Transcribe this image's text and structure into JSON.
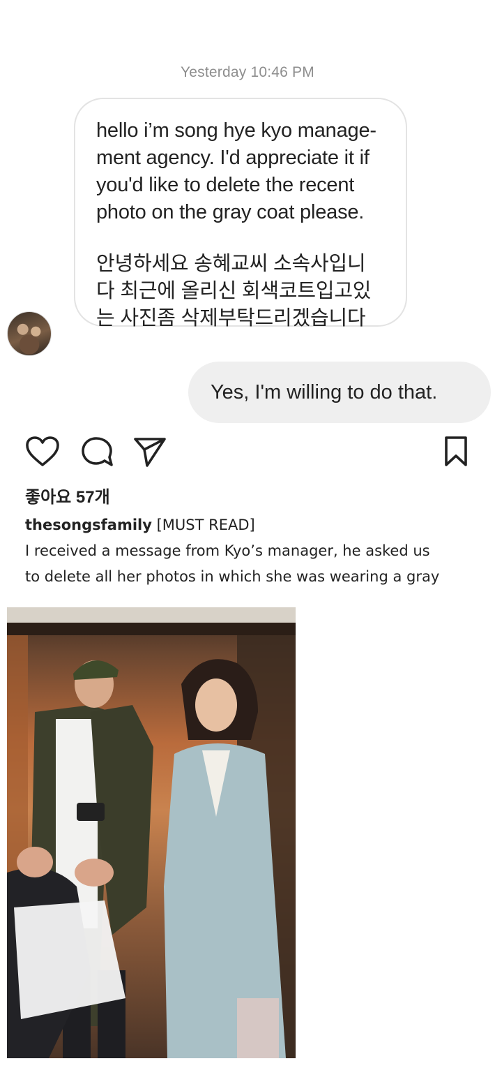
{
  "chat": {
    "timestamp": "Yesterday 10:46 PM",
    "incoming_lines": [
      "hello i’m song hye kyo manage-",
      "ment agency. I'd appreciate it if",
      "you'd like to delete the recent",
      "photo on the gray coat please.",
      "",
      "안녕하세요 송혜교씨 소속사입니",
      "다 최근에 올리신 회색코트입고있",
      "는 사진좀 삭제부탁드리겠습니다"
    ],
    "outgoing": "Yes, I'm willing to do that.",
    "avatar_icon": "profile-avatar"
  },
  "post": {
    "icons": {
      "like": "heart-icon",
      "comment": "comment-icon",
      "share": "send-icon",
      "save": "bookmark-icon"
    },
    "likes": "좋아요 57개",
    "username": "thesongsfamily",
    "caption_tag": "[MUST READ]",
    "caption_line1": "I received a message from Kyo’s manager, he asked us",
    "caption_line2": "to delete all her photos in which she was wearing a gray"
  },
  "colors": {
    "timestamp": "#8e8e8e",
    "bubble_border": "#e3e3e3",
    "outgoing_bg": "#efefef"
  }
}
